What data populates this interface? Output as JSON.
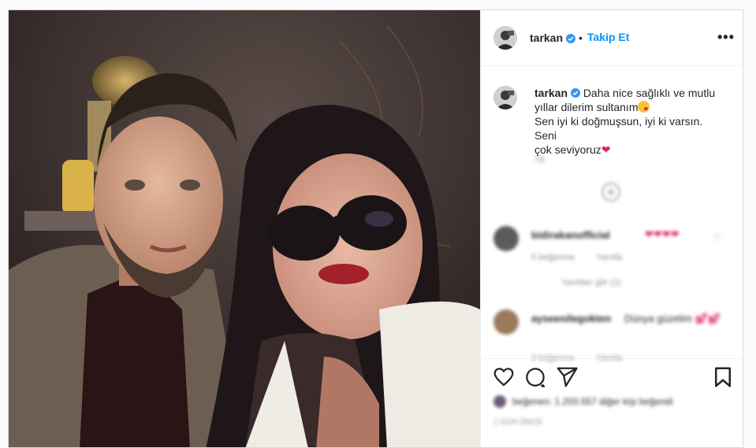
{
  "post": {
    "username": "tarkan",
    "follow_label": "Takip Et",
    "separator": "•",
    "more_label": "•••"
  },
  "caption": {
    "username": "tarkan",
    "line1": "Daha nice sağlıklı ve mutlu",
    "line2": "yıllar dilerim sultanım",
    "line3": "Sen iyi ki doğmuşsun, iyi ki varsın. Seni",
    "line4": "çok seviyoruz",
    "time_label": "1g"
  },
  "comments": [
    {
      "username": "bidirakanofficial",
      "text": "❤❤❤❤",
      "meta1": "6 beğenme",
      "meta2": "Yanıtla",
      "replies": "Yanıtları gör (1)"
    },
    {
      "username": "ayseenilegokten",
      "text": "Dünya güzelim 💕💕",
      "meta1": "3 beğenme",
      "meta2": "Yanıtla"
    }
  ],
  "likes_text": "beğenen: 1.203.557 diğer kişi beğendi",
  "time_text": "1 GÜN ÖNCE",
  "icons": {
    "like": "heart-icon",
    "comment": "comment-icon",
    "share": "share-icon",
    "save": "bookmark-icon",
    "verified": "verified-badge-icon",
    "load_more": "plus-circle-icon"
  },
  "colors": {
    "accent": "#0095f6",
    "verified": "#3897f0",
    "text": "#262626",
    "muted": "#8e8e8e"
  }
}
